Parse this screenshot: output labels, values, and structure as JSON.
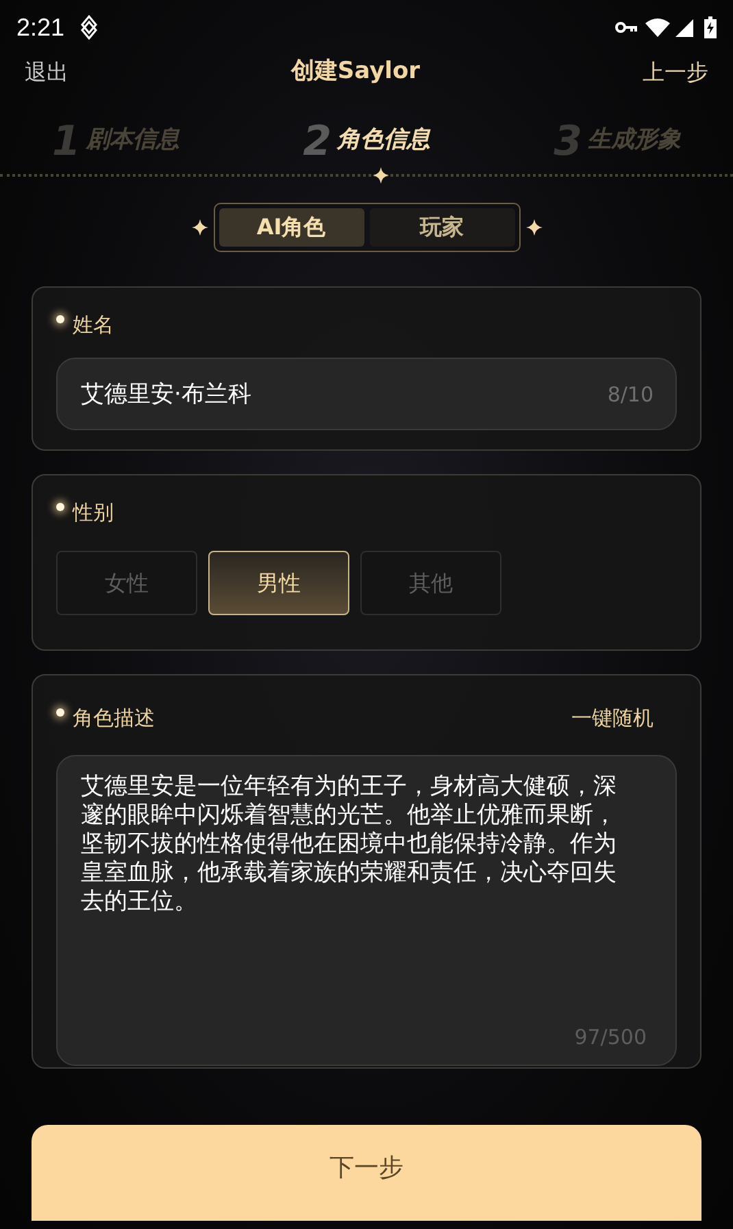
{
  "status_bar": {
    "time": "2:21"
  },
  "header": {
    "back": "退出",
    "title": "创建Saylor",
    "previous": "上一步"
  },
  "steps": [
    {
      "number": "1",
      "label": "剧本信息",
      "selected": false
    },
    {
      "number": "2",
      "label": "角色信息",
      "selected": true
    },
    {
      "number": "3",
      "label": "生成形象",
      "selected": false
    }
  ],
  "role_tabs": [
    {
      "label": "AI角色",
      "selected": true
    },
    {
      "label": "玩家",
      "selected": false
    }
  ],
  "name_card": {
    "label": "姓名",
    "value": "艾德里安·布兰科",
    "counter": "8/10"
  },
  "gender_card": {
    "label": "性别",
    "options": [
      {
        "label": "女性",
        "selected": false
      },
      {
        "label": "男性",
        "selected": true
      },
      {
        "label": "其他",
        "selected": false
      }
    ]
  },
  "description_card": {
    "label": "角色描述",
    "action": "一键随机",
    "value": "艾德里安是一位年轻有为的王子，身材高大健硕，深邃的眼眸中闪烁着智慧的光芒。他举止优雅而果断，坚韧不拔的性格使得他在困境中也能保持冷静。作为皇室血脉，他承载着家族的荣耀和责任，决心夺回失去的王位。",
    "counter": "97/500"
  },
  "next_button": "下一步"
}
